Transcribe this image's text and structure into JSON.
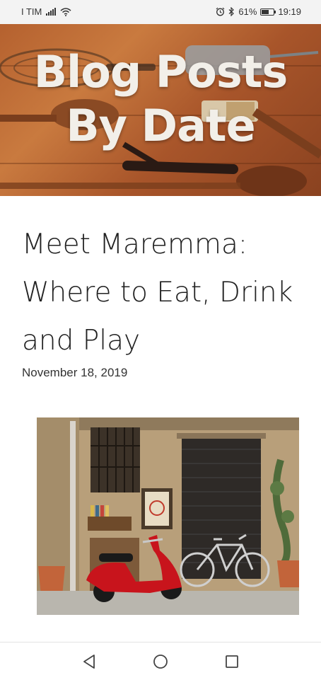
{
  "status_bar": {
    "carrier": "I TIM",
    "battery_percent": "61%",
    "battery_level": 0.61,
    "time": "19:19",
    "icons": [
      "signal-icon",
      "wifi-icon",
      "alarm-icon",
      "bluetooth-icon",
      "battery-icon"
    ]
  },
  "hero": {
    "title_line1": "Blog Posts",
    "title_line2": "By Date"
  },
  "post": {
    "title": "Meet Maremma: Where to Eat, Drink and Play",
    "date": "November 18, 2019"
  },
  "nav_bar": {
    "icons": [
      "back-icon",
      "home-icon",
      "recents-icon"
    ]
  },
  "colors": {
    "hero_wood": "#b5612f",
    "hero_text": "#f2efe9",
    "scooter_red": "#c8141c",
    "nav_icon": "#444444"
  }
}
